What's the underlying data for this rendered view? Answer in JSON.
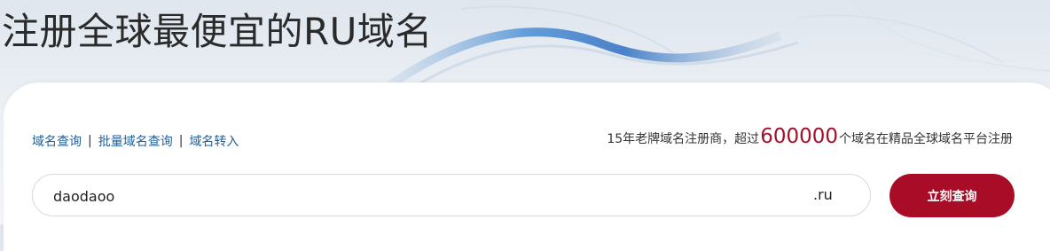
{
  "hero": {
    "title": "注册全球最便宜的RU域名"
  },
  "nav_links": {
    "domain_query": "域名查询",
    "separator": "|",
    "bulk_query": "批量域名查询",
    "domain_transfer": "域名转入"
  },
  "slogan": {
    "prefix": "15年老牌域名注册商，超过",
    "number": "600000",
    "suffix": "个域名在精品全球域名平台注册"
  },
  "search": {
    "value": "daodaoo",
    "suffix": ".ru",
    "button_label": "立刻查询"
  },
  "colors": {
    "brand_red": "#a80c27",
    "link_blue": "#1f5f9a",
    "number_red": "#a3102b"
  }
}
